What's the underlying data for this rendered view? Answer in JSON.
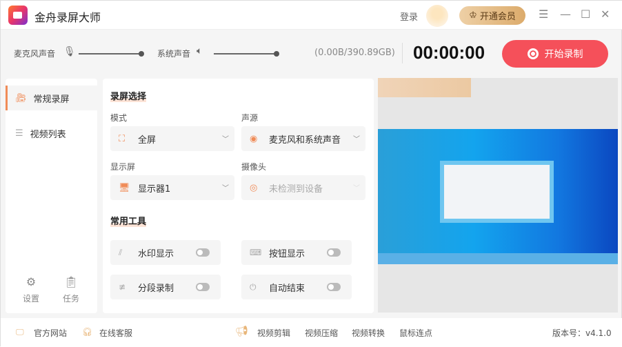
{
  "titlebar": {
    "app_title": "金舟录屏大师",
    "login": "登录",
    "vip": "开通会员"
  },
  "toolbar": {
    "mic_label": "麦克风声音",
    "mic_level": 1.0,
    "sys_label": "系统声音",
    "sys_level": 1.0,
    "storage": "(0.00B/390.89GB)",
    "timer": "00:00:00",
    "record": "开始录制"
  },
  "sidebar": {
    "items": [
      {
        "label": "常规录屏"
      },
      {
        "label": "视频列表"
      }
    ],
    "settings": "设置",
    "tasks": "任务"
  },
  "main": {
    "section1": "录屏选择",
    "mode_label": "模式",
    "mode_value": "全屏",
    "audio_label": "声源",
    "audio_value": "麦克风和系统声音",
    "display_label": "显示屏",
    "display_value": "显示器1",
    "camera_label": "摄像头",
    "camera_value": "未检测到设备",
    "section2": "常用工具",
    "tools": [
      {
        "label": "水印显示",
        "on": false
      },
      {
        "label": "按钮显示",
        "on": false
      },
      {
        "label": "分段录制",
        "on": false
      },
      {
        "label": "自动结束",
        "on": false
      }
    ]
  },
  "bottom": {
    "website": "官方网站",
    "support": "在线客服",
    "links": [
      "视频剪辑",
      "视频压缩",
      "视频转换",
      "鼠标连点"
    ],
    "version": "版本号：v4.1.0"
  },
  "colors": {
    "accent": "#f08b57",
    "record": "#f5505a"
  }
}
